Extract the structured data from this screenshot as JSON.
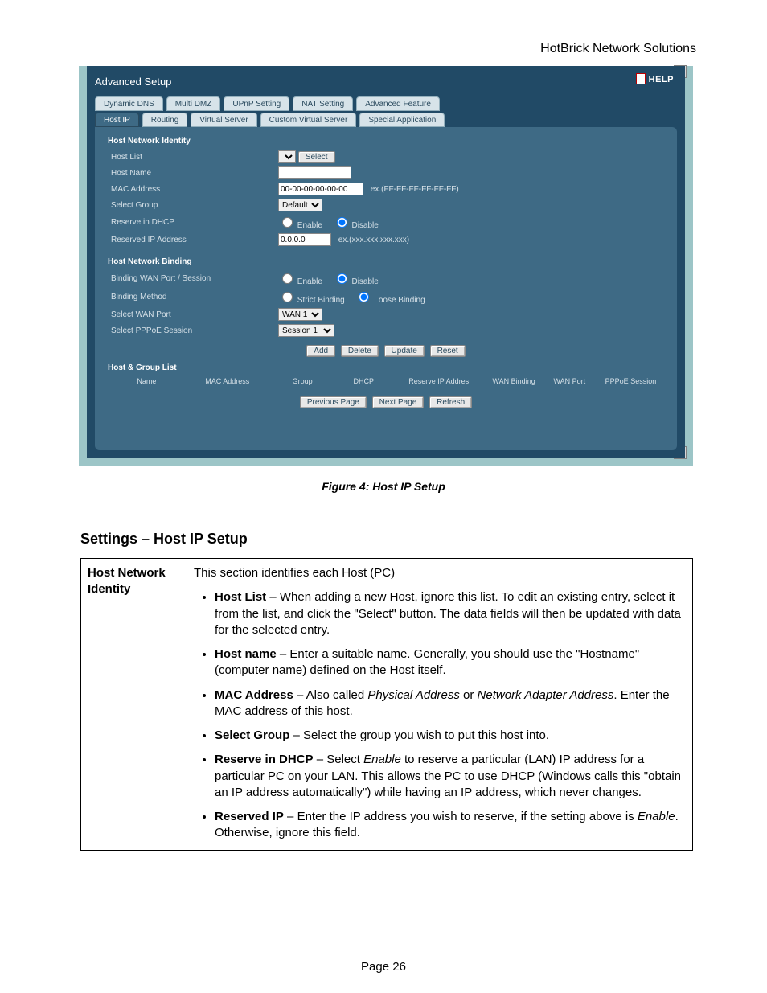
{
  "doc": {
    "company": "HotBrick Network Solutions",
    "figure_caption": "Figure 4: Host IP Setup",
    "settings_heading": "Settings – Host IP Setup",
    "page_number": "Page 26"
  },
  "ui": {
    "title": "Advanced Setup",
    "help": "HELP",
    "tabs_row1": [
      "Dynamic DNS",
      "Multi DMZ",
      "UPnP Setting",
      "NAT Setting",
      "Advanced Feature"
    ],
    "tabs_row2": [
      "Host IP",
      "Routing",
      "Virtual Server",
      "Custom Virtual Server",
      "Special Application"
    ],
    "active_tab": "Host IP",
    "sections": {
      "s1": "Host Network Identity",
      "s2": "Host Network Binding",
      "s3": "Host & Group List"
    },
    "labels": {
      "host_list": "Host List",
      "host_name": "Host Name",
      "mac_address": "MAC Address",
      "select_group": "Select Group",
      "reserve_dhcp": "Reserve in DHCP",
      "reserved_ip": "Reserved IP Address",
      "binding_wan": "Binding WAN Port / Session",
      "binding_method": "Binding Method",
      "select_wan_port": "Select WAN Port",
      "select_pppoe": "Select PPPoE Session"
    },
    "values": {
      "mac": "00-00-00-00-00-00",
      "mac_hint": "ex.(FF-FF-FF-FF-FF-FF)",
      "group": "Default",
      "reserved_ip": "0.0.0.0",
      "reserved_ip_hint": "ex.(xxx.xxx.xxx.xxx)",
      "wan_port": "WAN 1",
      "pppoe": "Session 1"
    },
    "radio": {
      "enable": "Enable",
      "disable": "Disable",
      "strict": "Strict Binding",
      "loose": "Loose Binding"
    },
    "buttons": {
      "select": "Select",
      "add": "Add",
      "delete": "Delete",
      "update": "Update",
      "reset": "Reset",
      "prev": "Previous Page",
      "next": "Next Page",
      "refresh": "Refresh"
    },
    "list_columns": [
      "Name",
      "MAC Address",
      "Group",
      "DHCP",
      "Reserve IP Addres",
      "WAN Binding",
      "WAN Port",
      "PPPoE Session"
    ]
  },
  "table": {
    "row_head": "Host Network Identity",
    "intro": "This section identifies each Host (PC)",
    "bullets": {
      "b1_bold": "Host List",
      "b1_rest": " – When adding a new Host, ignore this list. To edit an existing entry, select it from the list, and click the \"Select\" button. The data fields will then be updated with data for the selected entry.",
      "b2_bold": "Host name",
      "b2_rest": " – Enter a suitable name. Generally, you should use the \"Hostname\" (computer name) defined on the Host itself.",
      "b3_bold": "MAC Address",
      "b3_mid1": " – Also called ",
      "b3_i1": "Physical Address",
      "b3_mid2": " or ",
      "b3_i2": "Network Adapter Address",
      "b3_rest": ". Enter the MAC address of this host.",
      "b4_bold": "Select Group",
      "b4_rest": " – Select the group you wish to put this host into.",
      "b5_bold": "Reserve in DHCP",
      "b5_mid1": " – Select ",
      "b5_i1": "Enable",
      "b5_rest": " to reserve a particular (LAN) IP address for a particular PC on your LAN. This allows the PC to use DHCP (Windows calls this \"obtain an IP address automatically\") while having an IP address, which never changes.",
      "b6_bold": "Reserved IP",
      "b6_mid1": " – Enter the IP address you wish to reserve, if the setting above is ",
      "b6_i1": "Enable",
      "b6_rest": ". Otherwise, ignore this field."
    }
  }
}
